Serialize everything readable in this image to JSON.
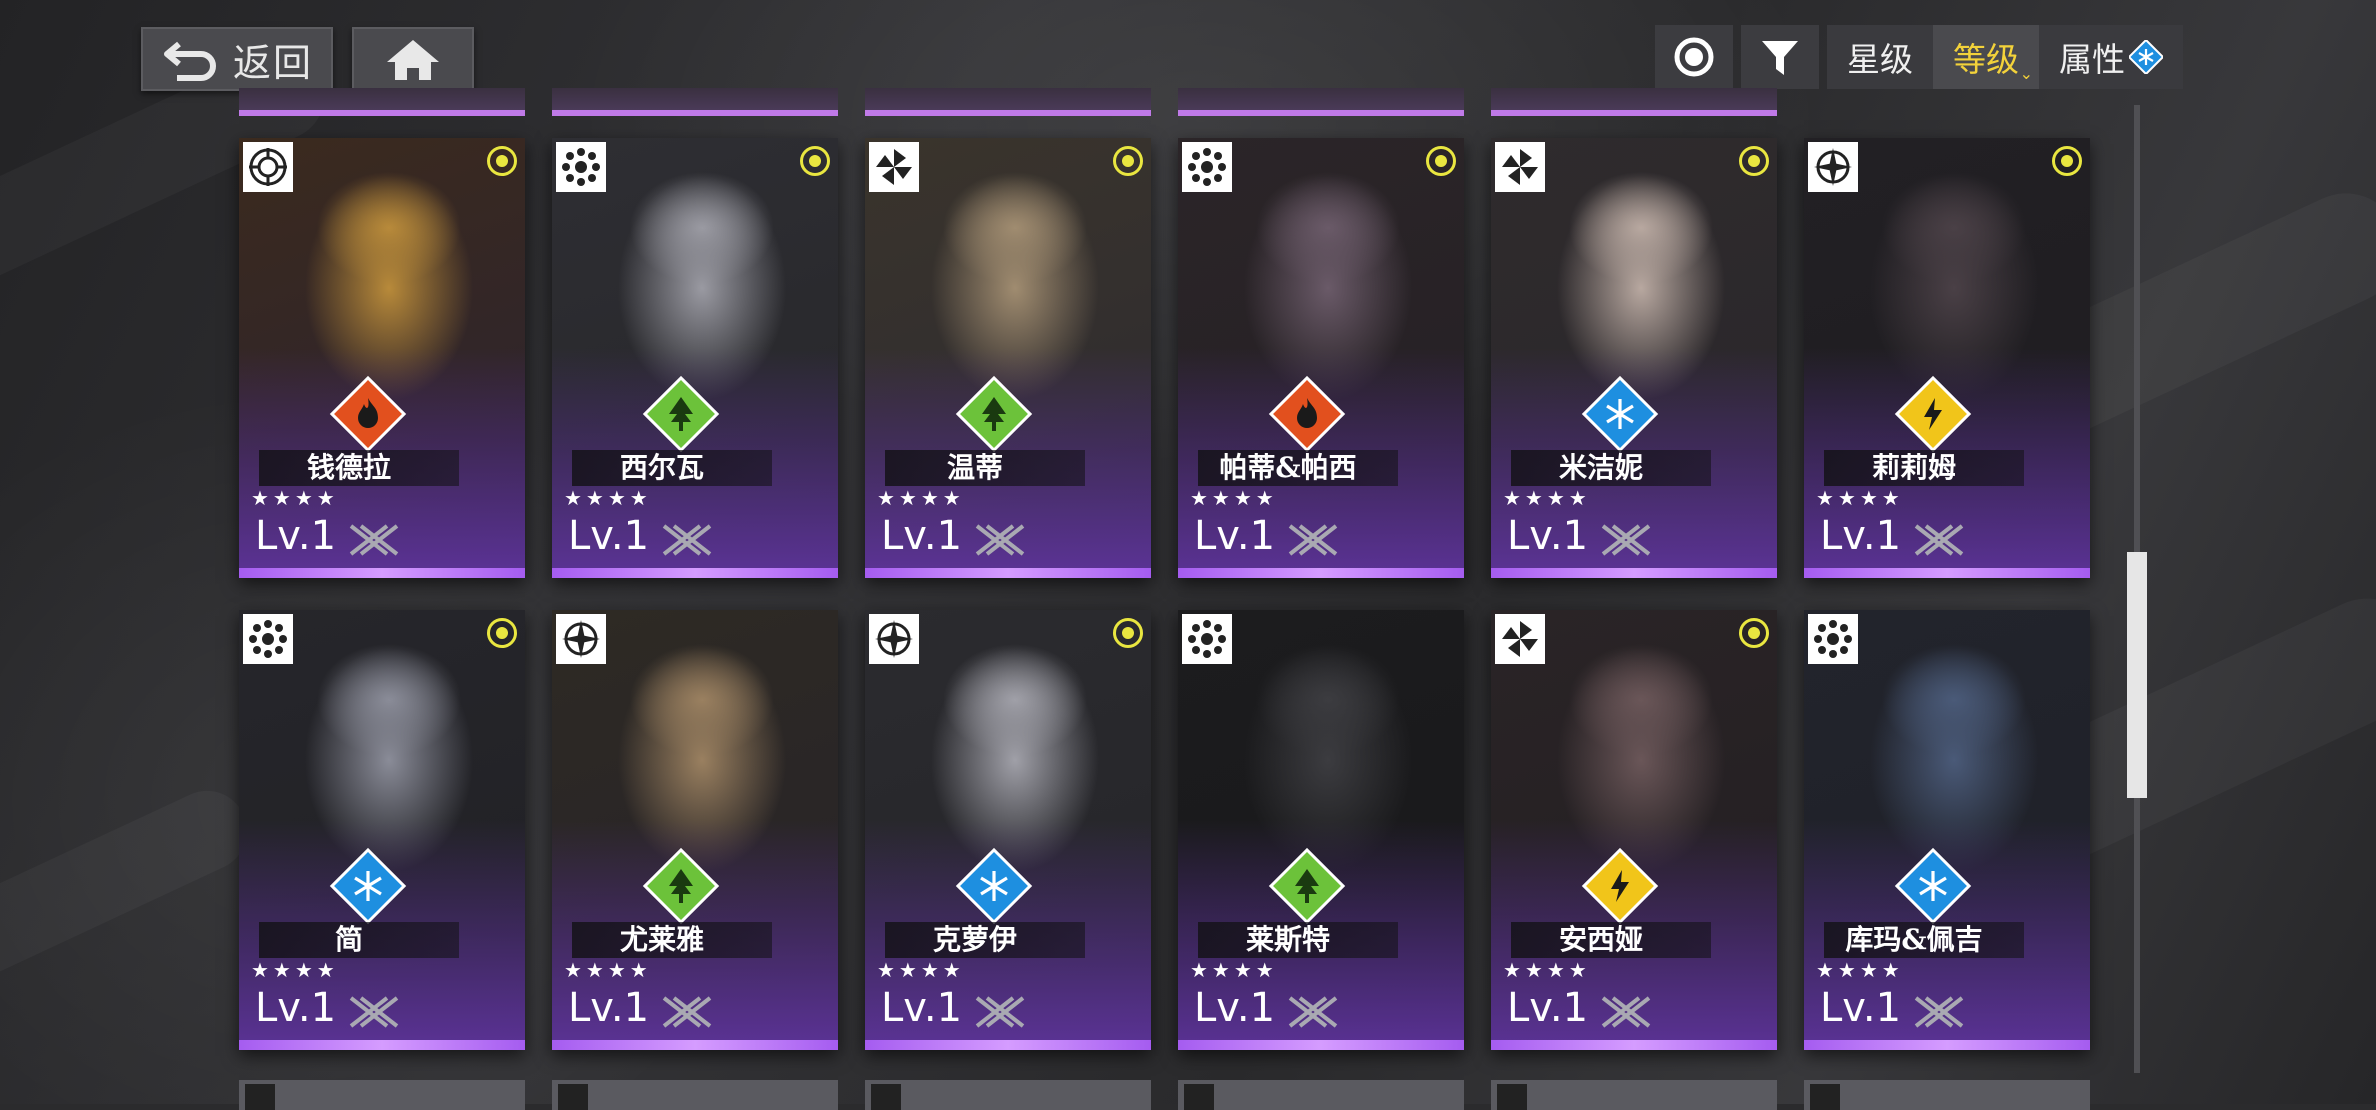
{
  "topbar": {
    "back_label": "返回",
    "back_icon": "back-arrow-icon",
    "home_icon": "home-icon"
  },
  "sortbar": {
    "toggle_icon": "circle-dot-icon",
    "filter_icon": "filter-funnel-icon",
    "tabs": [
      {
        "label": "星级",
        "active": false
      },
      {
        "label": "等级",
        "active": true
      },
      {
        "label": "属性",
        "active": false
      }
    ],
    "attribute_icon": "snowflake-icon"
  },
  "colors": {
    "fire": "#e2501e",
    "nature": "#6cc23a",
    "ice": "#1e8fe0",
    "lightning": "#f1c51a",
    "rarity_purple": "#b46cf3",
    "marked": "#e9e640",
    "active_tab": "#f3d23a"
  },
  "characters": [
    {
      "name": "钱德拉",
      "stars": "★★★★",
      "level": "Lv.1",
      "class_icon": "target-icon",
      "element": "fire",
      "marked": true
    },
    {
      "name": "西尔瓦",
      "stars": "★★★★",
      "level": "Lv.1",
      "class_icon": "gear-star-icon",
      "element": "nature",
      "marked": true
    },
    {
      "name": "温蒂",
      "stars": "★★★★",
      "level": "Lv.1",
      "class_icon": "pinwheel-icon",
      "element": "nature",
      "marked": true
    },
    {
      "name": "帕蒂&帕西",
      "stars": "★★★★",
      "level": "Lv.1",
      "class_icon": "gear-star-icon",
      "element": "fire",
      "marked": true
    },
    {
      "name": "米洁妮",
      "stars": "★★★★",
      "level": "Lv.1",
      "class_icon": "pinwheel-icon",
      "element": "ice",
      "marked": true
    },
    {
      "name": "莉莉姆",
      "stars": "★★★★",
      "level": "Lv.1",
      "class_icon": "compass-icon",
      "element": "lightning",
      "marked": true
    },
    {
      "name": "简",
      "stars": "★★★★",
      "level": "Lv.1",
      "class_icon": "gear-star-icon",
      "element": "ice",
      "marked": true
    },
    {
      "name": "尤莱雅",
      "stars": "★★★★",
      "level": "Lv.1",
      "class_icon": "compass-icon",
      "element": "nature",
      "marked": false
    },
    {
      "name": "克萝伊",
      "stars": "★★★★",
      "level": "Lv.1",
      "class_icon": "compass-icon",
      "element": "ice",
      "marked": true
    },
    {
      "name": "莱斯特",
      "stars": "★★★★",
      "level": "Lv.1",
      "class_icon": "gear-star-icon",
      "element": "nature",
      "marked": false
    },
    {
      "name": "安西娅",
      "stars": "★★★★",
      "level": "Lv.1",
      "class_icon": "pinwheel-icon",
      "element": "lightning",
      "marked": true
    },
    {
      "name": "库玛&佩吉",
      "stars": "★★★★",
      "level": "Lv.1",
      "class_icon": "gear-star-icon",
      "element": "ice",
      "marked": false
    }
  ]
}
